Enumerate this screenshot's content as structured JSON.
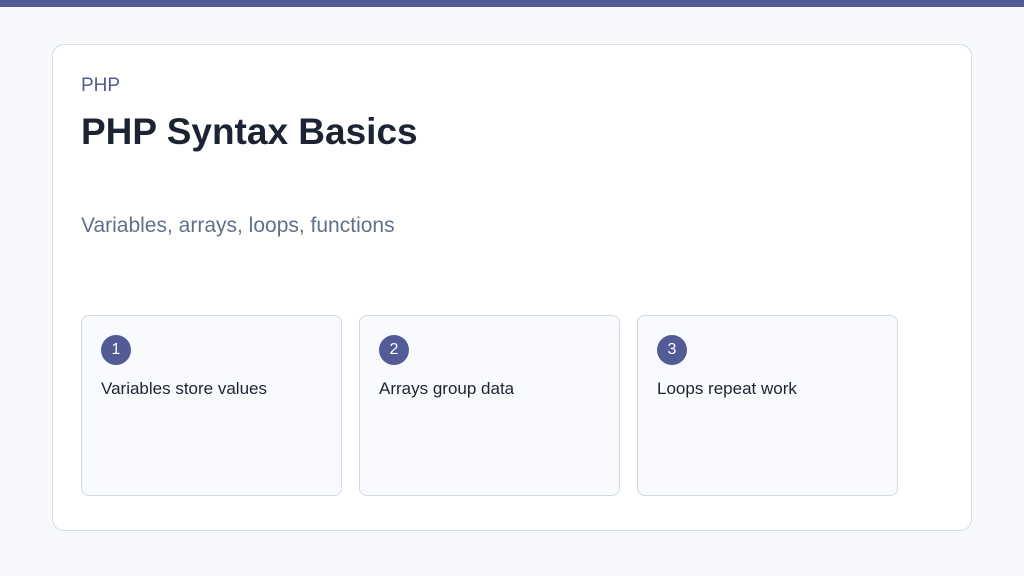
{
  "theme": {
    "accent": "#525b96",
    "title_color": "#1c2434",
    "subtitle_color": "#61708a",
    "background": "#f6f8fb"
  },
  "slide": {
    "eyebrow": "PHP",
    "title": "PHP Syntax Basics",
    "subtitle": "Variables, arrays, loops, functions",
    "steps": [
      {
        "number": "1",
        "text": "Variables store values"
      },
      {
        "number": "2",
        "text": "Arrays group data"
      },
      {
        "number": "3",
        "text": "Loops repeat work"
      }
    ]
  }
}
